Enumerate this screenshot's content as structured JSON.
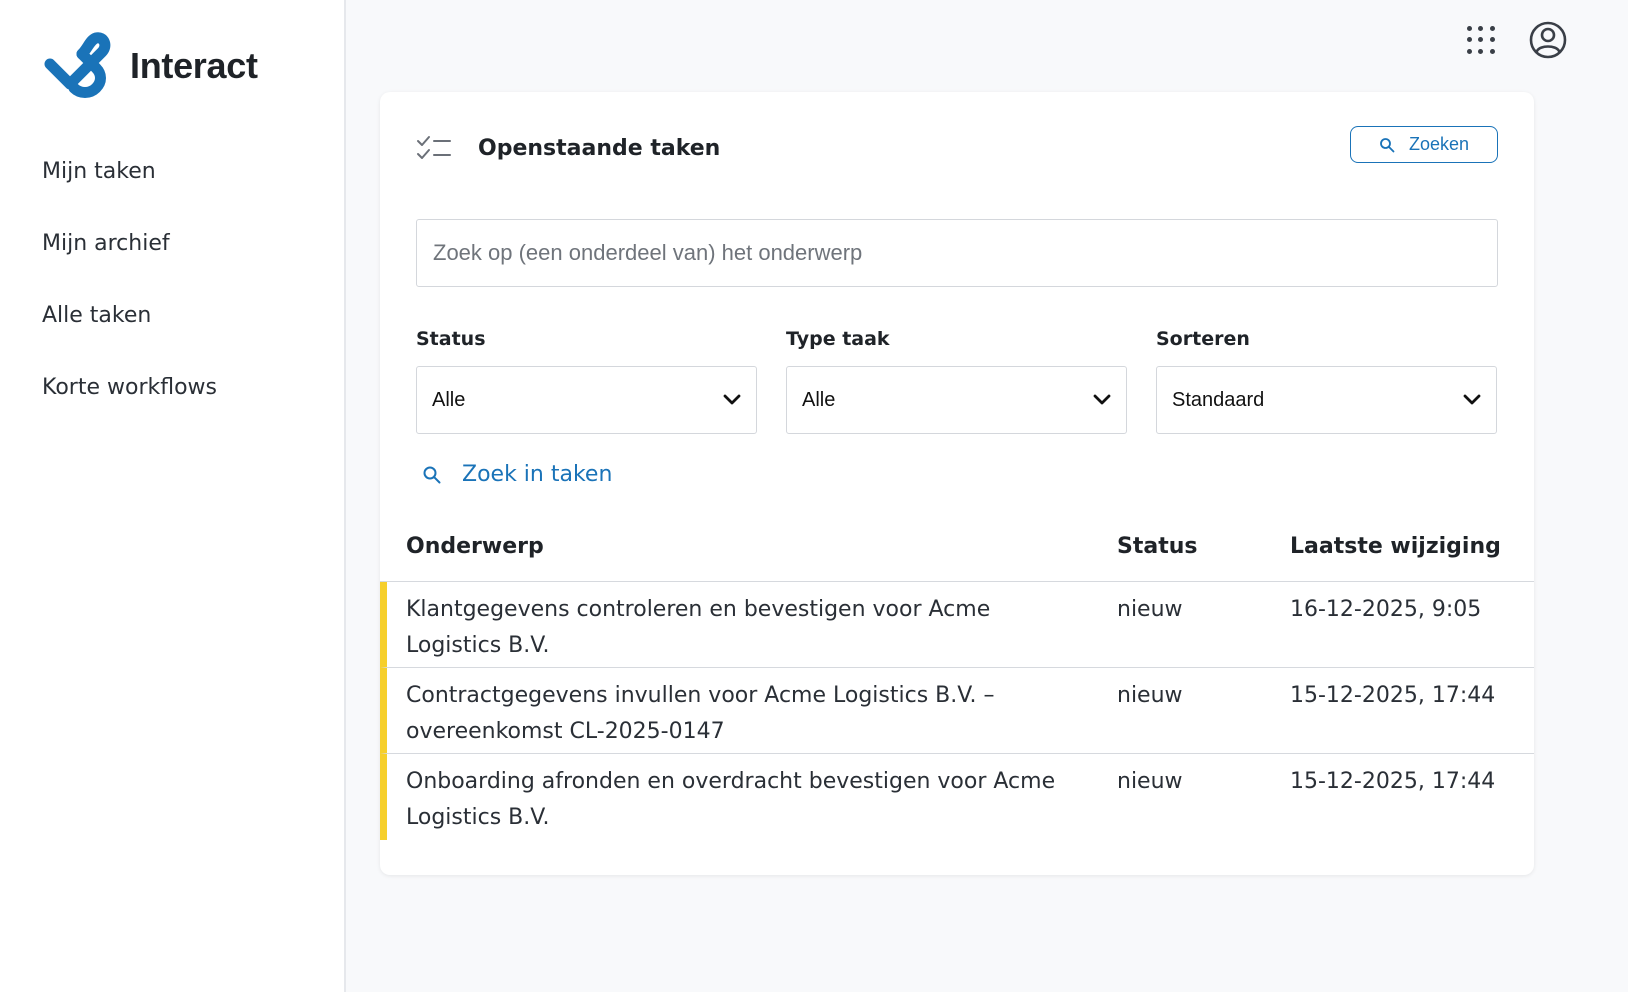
{
  "app": {
    "name": "Interact",
    "brand_color": "#1a73b8"
  },
  "sidebar": {
    "items": [
      {
        "label": "Mijn taken"
      },
      {
        "label": "Mijn archief"
      },
      {
        "label": "Alle taken"
      },
      {
        "label": "Korte workflows"
      }
    ]
  },
  "topbar": {
    "icons": [
      "apps-grid-icon",
      "user-account-icon"
    ]
  },
  "card": {
    "title": "Openstaande taken",
    "search_button_label": "Zoeken",
    "query_placeholder": "Zoek op (een onderdeel van) het onderwerp",
    "query_value": "",
    "filters": [
      {
        "label": "Status",
        "value": "Alle"
      },
      {
        "label": "Type taak",
        "value": "Alle"
      },
      {
        "label": "Sorteren",
        "value": "Standaard"
      }
    ],
    "search_link_label": "Zoek in taken"
  },
  "table": {
    "columns": [
      "Onderwerp",
      "Status",
      "Laatste wijziging"
    ],
    "row_marker_color": "#f6cf2c",
    "rows": [
      {
        "subject": "Klantgegevens controleren en bevestigen voor Acme Logistics B.V.",
        "status": "nieuw",
        "modified": "16-12-2025, 9:05"
      },
      {
        "subject": "Contractgegevens invullen voor Acme Logistics B.V. – overeenkomst CL-2025-0147",
        "status": "nieuw",
        "modified": "15-12-2025, 17:44"
      },
      {
        "subject": "Onboarding afronden en overdracht bevestigen voor Acme Logistics B.V.",
        "status": "nieuw",
        "modified": "15-12-2025, 17:44"
      }
    ]
  }
}
